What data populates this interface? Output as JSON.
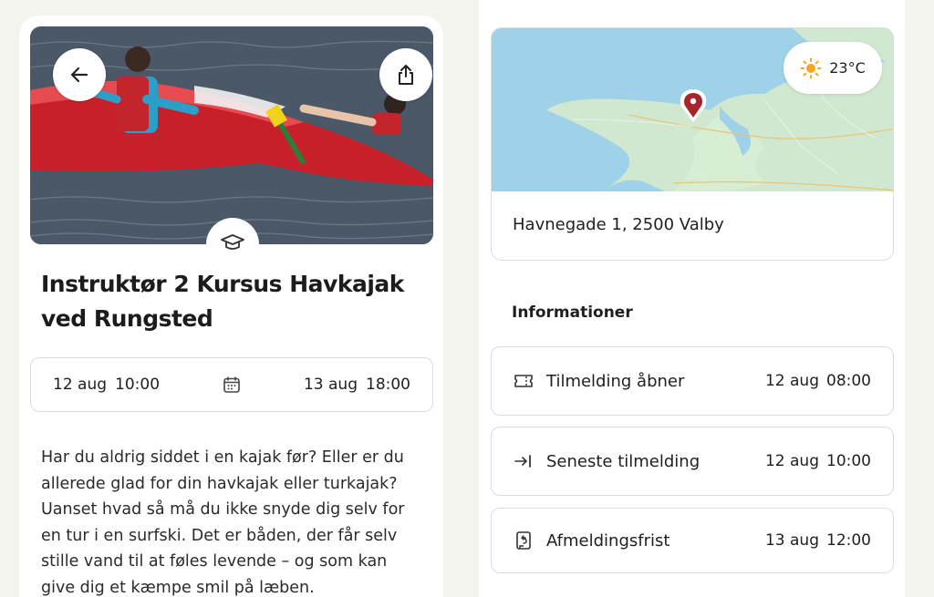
{
  "event": {
    "title": "Instruktør 2 Kursus Havkajak ved Rungsted",
    "start_date": "12 aug",
    "start_time": "10:00",
    "end_date": "13 aug",
    "end_time": "18:00",
    "description": "Har du aldrig siddet i en kajak før? Eller er du allerede glad for din havkajak eller turkajak? Uanset hvad så må du ikke snyde dig selv for en tur i en surfski. Det er båden, der får selv stille vand til at føles levende – og som kan give dig et kæmpe smil på læben."
  },
  "hero": {
    "back_icon": "arrow-left-icon",
    "share_icon": "share-icon",
    "category_icon": "graduation-cap-icon"
  },
  "location": {
    "weather_temp": "23°C",
    "weather_icon": "sun-icon",
    "address": "Havnegade 1, 2500 Valby"
  },
  "info": {
    "heading": "Informationer",
    "rows": [
      {
        "icon": "ticket-icon",
        "label": "Tilmelding åbner",
        "date": "12 aug",
        "time": "08:00"
      },
      {
        "icon": "arrow-to-line-icon",
        "label": "Seneste tilmelding",
        "date": "12 aug",
        "time": "10:00"
      },
      {
        "icon": "cancel-doc-icon",
        "label": "Afmeldingsfrist",
        "date": "13 aug",
        "time": "12:00"
      }
    ]
  },
  "colors": {
    "page_bg": "#f4f4ef",
    "card_bg": "#ffffff",
    "border": "#dcdcdc",
    "pin": "#a8262b",
    "sun": "#f5a623"
  }
}
